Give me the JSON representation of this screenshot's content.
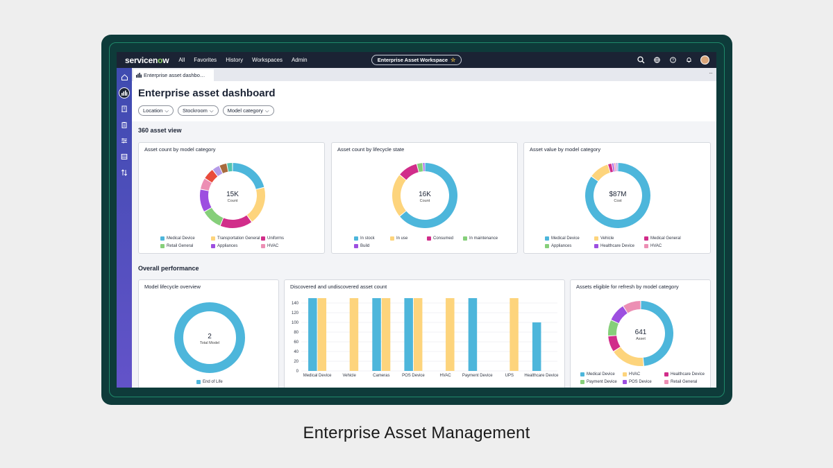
{
  "topbar": {
    "logo_text": "servicen",
    "logo_o": "o",
    "logo_end": "w",
    "nav": [
      "All",
      "Favorites",
      "History",
      "Workspaces",
      "Admin"
    ],
    "workspace_label": "Enterprise Asset Workspace"
  },
  "tab": {
    "label": "Enterprise asset dashbo…"
  },
  "header": {
    "title": "Enterprise asset dashboard",
    "filters": [
      "Location",
      "Stockroom",
      "Model category"
    ]
  },
  "sections": {
    "view360": "360 asset view",
    "performance": "Overall performance"
  },
  "colors": {
    "blue": "#4db6db",
    "yellow": "#fdd47c",
    "magenta": "#d12d8a",
    "green": "#86cf7a",
    "purple": "#9d4fe0",
    "pink": "#ec8fb4",
    "orange": "#f07f3c",
    "red": "#e94b3c",
    "lilac": "#b59be8",
    "brown": "#a86a3d",
    "teal": "#53c4b0"
  },
  "cards": {
    "count_by_category": {
      "title": "Asset count by model category",
      "center_value": "15K",
      "center_label": "Count",
      "legend": [
        "Medical Device",
        "Transportation General",
        "Uniforms",
        "Retail General",
        "Appliances",
        "HVAC"
      ]
    },
    "count_by_lifecycle": {
      "title": "Asset count by lifecycle state",
      "center_value": "16K",
      "center_label": "Count",
      "legend": [
        "In stock",
        "In use",
        "Consumed",
        "In maintenance",
        "Build"
      ]
    },
    "value_by_category": {
      "title": "Asset value by model category",
      "center_value": "$87M",
      "center_label": "Cost",
      "legend": [
        "Medical Device",
        "Vehicle",
        "Medical General",
        "Appliances",
        "Healthcare Device",
        "HVAC"
      ]
    },
    "lifecycle_overview": {
      "title": "Model lifecycle overview",
      "center_value": "2",
      "center_label": "Total Model",
      "legend": [
        "End of Life"
      ]
    },
    "discovered": {
      "title": "Discovered and undiscovered asset count"
    },
    "refresh": {
      "title": "Assets eligible for refresh by model category",
      "center_value": "641",
      "center_label": "Asset",
      "legend": [
        "Medical Device",
        "HVAC",
        "Healthcare Device",
        "Payment Device",
        "POS Device",
        "Retail General"
      ]
    }
  },
  "chart_data": {
    "type": "bar",
    "categories": [
      "Medical Device",
      "Vehicle",
      "Cameras",
      "POS Device",
      "HVAC",
      "Payment Device",
      "UPS",
      "Healthcare Device"
    ],
    "series": [
      {
        "color": "#4db6db",
        "values": [
          150,
          0,
          150,
          150,
          0,
          150,
          0,
          100
        ]
      },
      {
        "color": "#fdd47c",
        "values": [
          150,
          150,
          150,
          150,
          150,
          0,
          150,
          0
        ]
      }
    ],
    "y_ticks": [
      "140",
      "120",
      "100",
      "80",
      "60",
      "40",
      "20",
      "0"
    ],
    "ylim": [
      0,
      150
    ],
    "grid": true
  },
  "caption": "Enterprise Asset Management"
}
